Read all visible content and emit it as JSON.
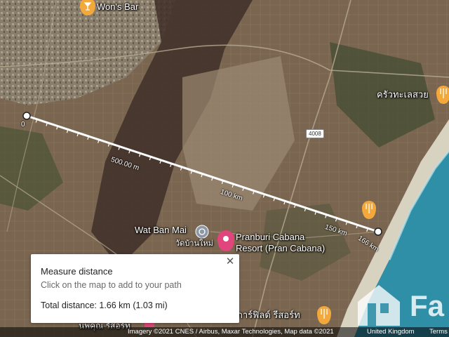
{
  "map": {
    "places": {
      "wons_bar": "Won's Bar",
      "seafood_thai": "ครัวทะเลสวย",
      "wat_ban_mai": "Wat Ban Mai",
      "wat_ban_mai_thai": "วัดบ้านใหม่",
      "pranburi_line1": "Pranburi Cabana",
      "pranburi_line2": "Resort (Pran Cabana)",
      "garfield_thai": "การ์ฟิลด์ รีสอร์ท",
      "bottom_thai_partial": "นพคุณ รีสอร์ท"
    },
    "road_shield": "4008",
    "distance_labels": {
      "start": "0",
      "d500": "500.00 m",
      "d100": "100 km",
      "d150": "150 km",
      "d166": "166 km"
    }
  },
  "measure_panel": {
    "title": "Measure distance",
    "hint": "Click on the map to add to your path",
    "total": "Total distance: 1.66 km (1.03 mi)",
    "close": "✕"
  },
  "attribution": {
    "imagery": "Imagery ©2021 CNES / Airbus, Maxar Technologies, Map data ©2021",
    "region": "United Kingdom",
    "terms": "Terms"
  },
  "watermark": {
    "text": "Fa"
  },
  "colors": {
    "sea": "#2f8fa6",
    "marker_orange": "#f2a83a",
    "marker_pink": "#e0457b",
    "measure_line": "#ffffff"
  }
}
